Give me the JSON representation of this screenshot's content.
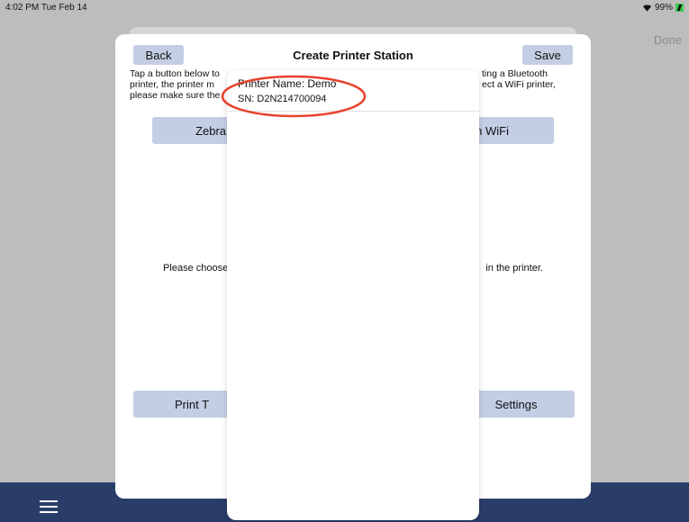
{
  "status_bar": {
    "time": "4:02 PM  Tue Feb 14",
    "battery": "99%"
  },
  "background": {
    "done_label": "Done",
    "menu_icon": "hamburger-icon"
  },
  "modal": {
    "title": "Create Printer Station",
    "back_label": "Back",
    "save_label": "Save",
    "intro_line1_left": "Tap a button below to",
    "intro_line1_right": "ting a Bluetooth",
    "intro_line2_left": "printer, the printer m",
    "intro_line2_right": "ect a WiFi printer,",
    "intro_line3_left": "please make sure the",
    "zebra_wifi_label": "Zebra W",
    "right_wifi_label": "lon WiFi",
    "choose_left": "Please choose",
    "choose_right": "in the printer.",
    "print_test_label": "Print T",
    "settings_label": "Settings"
  },
  "popover": {
    "printers": [
      {
        "name": "Printer Name: Demo",
        "sn": "SN: D2N214700094"
      }
    ]
  },
  "colors": {
    "button_fill": "#c3cee4",
    "bottom_bar": "#2a3d69",
    "highlight": "#e8412c",
    "battery": "#39c94e"
  }
}
